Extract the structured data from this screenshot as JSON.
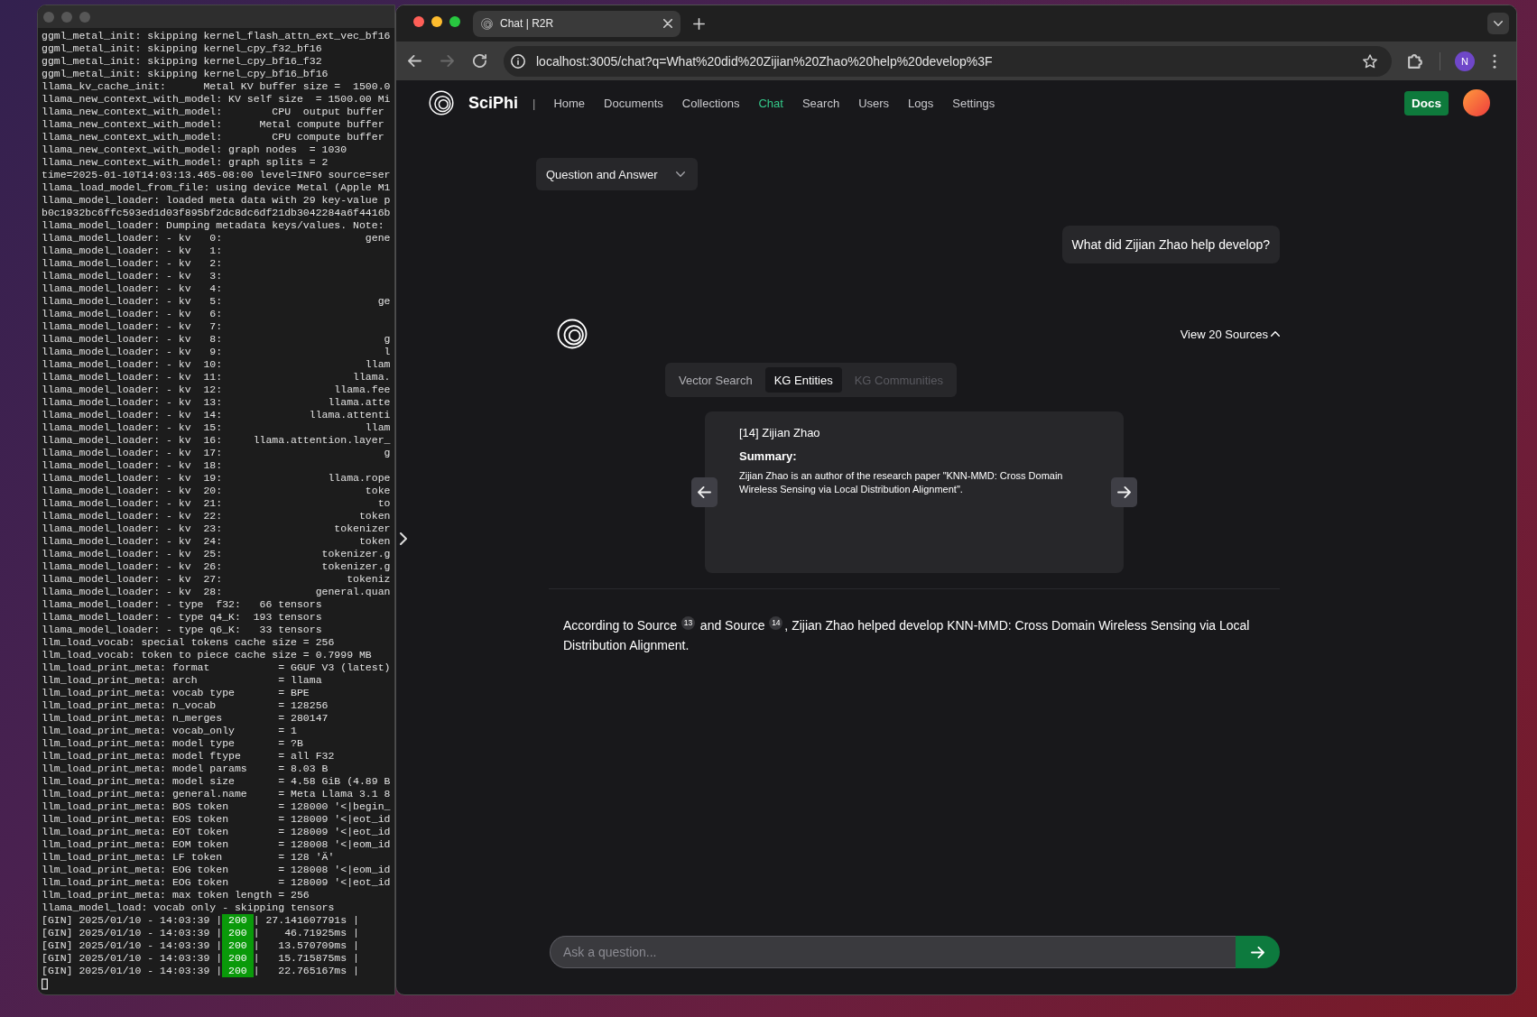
{
  "terminal": {
    "lines": [
      {
        "kind": "text",
        "text": "ggml_metal_init: skipping kernel_flash_attn_ext_vec_bf16"
      },
      {
        "kind": "text",
        "text": "ggml_metal_init: skipping kernel_cpy_f32_bf16"
      },
      {
        "kind": "text",
        "text": "ggml_metal_init: skipping kernel_cpy_bf16_f32"
      },
      {
        "kind": "text",
        "text": "ggml_metal_init: skipping kernel_cpy_bf16_bf16"
      },
      {
        "kind": "text",
        "text": "llama_kv_cache_init:      Metal KV buffer size =  1500.0"
      },
      {
        "kind": "text",
        "text": "llama_new_context_with_model: KV self size  = 1500.00 Mi"
      },
      {
        "kind": "text",
        "text": "llama_new_context_with_model:        CPU  output buffer"
      },
      {
        "kind": "text",
        "text": "llama_new_context_with_model:      Metal compute buffer"
      },
      {
        "kind": "text",
        "text": "llama_new_context_with_model:        CPU compute buffer"
      },
      {
        "kind": "text",
        "text": "llama_new_context_with_model: graph nodes  = 1030"
      },
      {
        "kind": "text",
        "text": "llama_new_context_with_model: graph splits = 2"
      },
      {
        "kind": "text",
        "text": "time=2025-01-10T14:03:13.465-08:00 level=INFO source=ser"
      },
      {
        "kind": "text",
        "text": "llama_load_model_from_file: using device Metal (Apple M1"
      },
      {
        "kind": "text",
        "text": "llama_model_loader: loaded meta data with 29 key-value p"
      },
      {
        "kind": "text",
        "text": "b0c1932bc6ffc593ed1d03f895bf2dc8dc6df21db3042284a6f4416b"
      },
      {
        "kind": "text",
        "text": "llama_model_loader: Dumping metadata keys/values. Note:"
      },
      {
        "kind": "kv",
        "key": "llama_model_loader: - kv   0:",
        "value": "gene"
      },
      {
        "kind": "kv",
        "key": "llama_model_loader: - kv   1:"
      },
      {
        "kind": "kv",
        "key": "llama_model_loader: - kv   2:"
      },
      {
        "kind": "kv",
        "key": "llama_model_loader: - kv   3:"
      },
      {
        "kind": "kv",
        "key": "llama_model_loader: - kv   4:"
      },
      {
        "kind": "kv",
        "key": "llama_model_loader: - kv   5:",
        "value": "ge"
      },
      {
        "kind": "kv",
        "key": "llama_model_loader: - kv   6:"
      },
      {
        "kind": "kv",
        "key": "llama_model_loader: - kv   7:"
      },
      {
        "kind": "kv",
        "key": "llama_model_loader: - kv   8:",
        "value": "g"
      },
      {
        "kind": "kv",
        "key": "llama_model_loader: - kv   9:",
        "value": "l"
      },
      {
        "kind": "kv",
        "key": "llama_model_loader: - kv  10:",
        "value": "llam"
      },
      {
        "kind": "kv",
        "key": "llama_model_loader: - kv  11:",
        "value": "llama."
      },
      {
        "kind": "kv",
        "key": "llama_model_loader: - kv  12:",
        "value": "llama.fee"
      },
      {
        "kind": "kv",
        "key": "llama_model_loader: - kv  13:",
        "value": "llama.atte"
      },
      {
        "kind": "kv",
        "key": "llama_model_loader: - kv  14:",
        "value": "llama.attenti"
      },
      {
        "kind": "kv",
        "key": "llama_model_loader: - kv  15:",
        "value": "llam"
      },
      {
        "kind": "kv",
        "key": "llama_model_loader: - kv  16:",
        "value": "llama.attention.layer_"
      },
      {
        "kind": "kv",
        "key": "llama_model_loader: - kv  17:",
        "value": "g"
      },
      {
        "kind": "kv",
        "key": "llama_model_loader: - kv  18:"
      },
      {
        "kind": "kv",
        "key": "llama_model_loader: - kv  19:",
        "value": "llama.rope"
      },
      {
        "kind": "kv",
        "key": "llama_model_loader: - kv  20:",
        "value": "toke"
      },
      {
        "kind": "kv",
        "key": "llama_model_loader: - kv  21:",
        "value": "to"
      },
      {
        "kind": "kv",
        "key": "llama_model_loader: - kv  22:",
        "value": "token"
      },
      {
        "kind": "kv",
        "key": "llama_model_loader: - kv  23:",
        "value": "tokenizer"
      },
      {
        "kind": "kv",
        "key": "llama_model_loader: - kv  24:",
        "value": "token"
      },
      {
        "kind": "kv",
        "key": "llama_model_loader: - kv  25:",
        "value": "tokenizer.g"
      },
      {
        "kind": "kv",
        "key": "llama_model_loader: - kv  26:",
        "value": "tokenizer.g"
      },
      {
        "kind": "kv",
        "key": "llama_model_loader: - kv  27:",
        "value": "tokeniz"
      },
      {
        "kind": "kv",
        "key": "llama_model_loader: - kv  28:",
        "value": "general.quan"
      },
      {
        "kind": "text",
        "text": "llama_model_loader: - type  f32:   66 tensors"
      },
      {
        "kind": "text",
        "text": "llama_model_loader: - type q4_K:  193 tensors"
      },
      {
        "kind": "text",
        "text": "llama_model_loader: - type q6_K:   33 tensors"
      },
      {
        "kind": "text",
        "text": "llm_load_vocab: special tokens cache size = 256"
      },
      {
        "kind": "text",
        "text": "llm_load_vocab: token to piece cache size = 0.7999 MB"
      },
      {
        "kind": "field",
        "key": "llm_load_print_meta: format",
        "value": "= GGUF V3 (latest)"
      },
      {
        "kind": "field",
        "key": "llm_load_print_meta: arch",
        "value": "= llama"
      },
      {
        "kind": "field",
        "key": "llm_load_print_meta: vocab type",
        "value": "= BPE"
      },
      {
        "kind": "field",
        "key": "llm_load_print_meta: n_vocab",
        "value": "= 128256"
      },
      {
        "kind": "field",
        "key": "llm_load_print_meta: n_merges",
        "value": "= 280147"
      },
      {
        "kind": "field",
        "key": "llm_load_print_meta: vocab_only",
        "value": "= 1"
      },
      {
        "kind": "field",
        "key": "llm_load_print_meta: model type",
        "value": "= ?B"
      },
      {
        "kind": "field",
        "key": "llm_load_print_meta: model ftype",
        "value": "= all F32"
      },
      {
        "kind": "field",
        "key": "llm_load_print_meta: model params",
        "value": "= 8.03 B"
      },
      {
        "kind": "field",
        "key": "llm_load_print_meta: model size",
        "value": "= 4.58 GiB (4.89 B"
      },
      {
        "kind": "field",
        "key": "llm_load_print_meta: general.name",
        "value": "= Meta Llama 3.1 8"
      },
      {
        "kind": "field",
        "key": "llm_load_print_meta: BOS token",
        "value": "= 128000 '<|begin_"
      },
      {
        "kind": "field",
        "key": "llm_load_print_meta: EOS token",
        "value": "= 128009 '<|eot_id"
      },
      {
        "kind": "field",
        "key": "llm_load_print_meta: EOT token",
        "value": "= 128009 '<|eot_id"
      },
      {
        "kind": "field",
        "key": "llm_load_print_meta: EOM token",
        "value": "= 128008 '<|eom_id"
      },
      {
        "kind": "field",
        "key": "llm_load_print_meta: LF token",
        "value": "= 128 'Ä'"
      },
      {
        "kind": "field",
        "key": "llm_load_print_meta: EOG token",
        "value": "= 128008 '<|eom_id"
      },
      {
        "kind": "field",
        "key": "llm_load_print_meta: EOG token",
        "value": "= 128009 '<|eot_id"
      },
      {
        "kind": "field",
        "key": "llm_load_print_meta: max token length",
        "value": "= 256"
      },
      {
        "kind": "text",
        "text": "llama_model_load: vocab only - skipping tensors"
      },
      {
        "kind": "request",
        "text": "[GIN] 2025/01/10 - 14:03:39 |",
        "status": "200",
        "duration": "| 27.141607791s |"
      },
      {
        "kind": "request",
        "text": "[GIN] 2025/01/10 - 14:03:39 |",
        "status": "200",
        "duration": "|    46.71925ms |"
      },
      {
        "kind": "request",
        "text": "[GIN] 2025/01/10 - 14:03:39 |",
        "status": "200",
        "duration": "|   13.570709ms |"
      },
      {
        "kind": "request",
        "text": "[GIN] 2025/01/10 - 14:03:39 |",
        "status": "200",
        "duration": "|   15.715875ms |"
      },
      {
        "kind": "request",
        "text": "[GIN] 2025/01/10 - 14:03:39 |",
        "status": "200",
        "duration": "|   22.765167ms |"
      }
    ]
  },
  "browser": {
    "tabs": [
      {
        "title": "Chat | R2R",
        "selected": true
      }
    ],
    "toolbar_buttons": [
      {
        "kind": "back",
        "disabled": false
      },
      {
        "kind": "forward",
        "disabled": true
      },
      {
        "kind": "reload",
        "disabled": false
      }
    ],
    "address": "localhost:3005/chat?q=What%20did%20Zijian%20Zhao%20help%20develop%3F",
    "profile_initial": "N"
  },
  "app": {
    "brand": "SciPhi",
    "brand_separator": "|",
    "nav": [
      {
        "label": "Home",
        "selected": false
      },
      {
        "label": "Documents",
        "selected": false
      },
      {
        "label": "Collections",
        "selected": false
      },
      {
        "label": "Chat",
        "selected": true
      },
      {
        "label": "Search",
        "selected": false
      },
      {
        "label": "Users",
        "selected": false
      },
      {
        "label": "Logs",
        "selected": false
      },
      {
        "label": "Settings",
        "selected": false
      }
    ],
    "docs_button": "Docs",
    "mode_select": {
      "value": "Question and Answer"
    },
    "question": "What did Zijian Zhao help develop?",
    "sources_toggle": {
      "label": "View 20 Sources",
      "expanded": true
    },
    "source_tabs": [
      {
        "label": "Vector Search",
        "selected": false,
        "disabled": false
      },
      {
        "label": "KG Entities",
        "selected": true,
        "disabled": false
      },
      {
        "label": "KG Communities",
        "selected": false,
        "disabled": true
      }
    ],
    "entity_card": {
      "title": "[14] Zijian Zhao",
      "heading": "Summary:",
      "summary": "Zijian Zhao is an author of the research paper \"KNN-MMD: Cross Domain Wireless Sensing via Local Distribution Alignment\"."
    },
    "answer": "According to Source $^{13}$ and Source $^{14}$, Zijian Zhao helped develop KNN-MMD: Cross Domain Wireless Sensing via Local Distribution Alignment.",
    "input": {
      "placeholder": "Ask a question..."
    }
  }
}
